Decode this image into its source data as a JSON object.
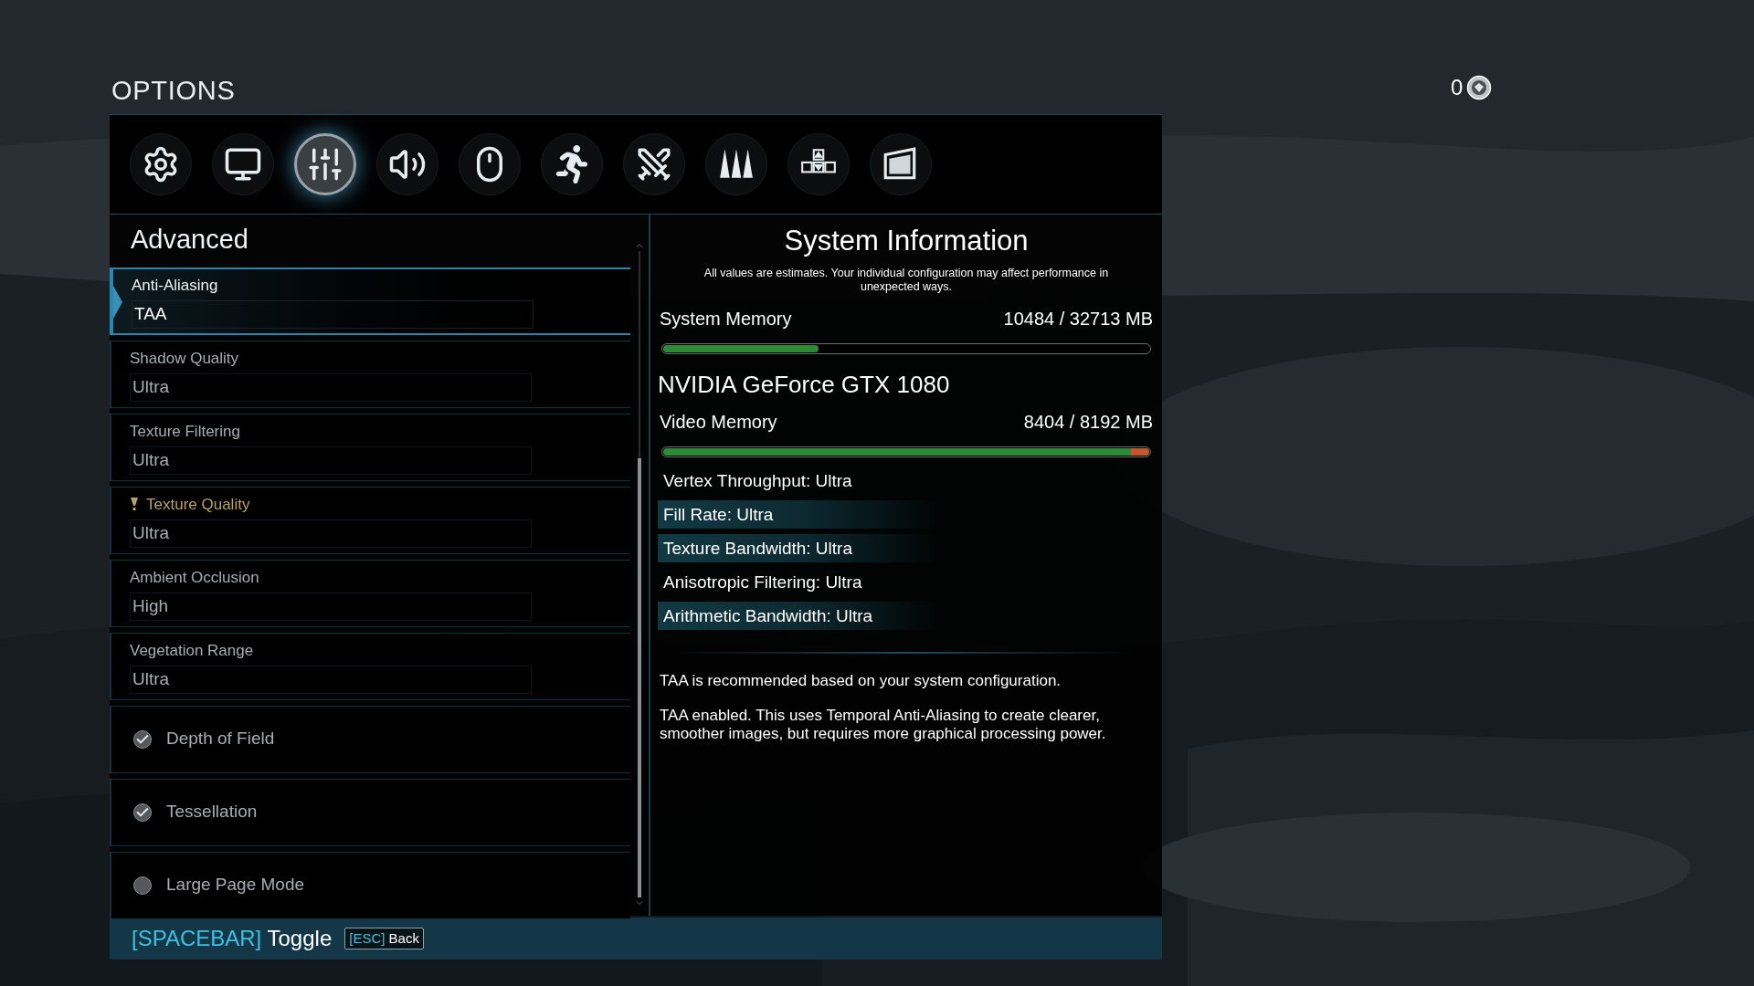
{
  "title": "OPTIONS",
  "currency": {
    "amount": "0"
  },
  "tabs": [
    {
      "kind": "general",
      "selected": false
    },
    {
      "kind": "display",
      "selected": false
    },
    {
      "kind": "graphics",
      "selected": true
    },
    {
      "kind": "audio",
      "selected": false
    },
    {
      "kind": "mouse",
      "selected": false
    },
    {
      "kind": "movement",
      "selected": false
    },
    {
      "kind": "combat",
      "selected": false
    },
    {
      "kind": "claws",
      "selected": false
    },
    {
      "kind": "keys",
      "selected": false
    },
    {
      "kind": "screen",
      "selected": false
    }
  ],
  "section": "Advanced",
  "settings": [
    {
      "kind": "dropdown",
      "label": "Anti-Aliasing",
      "value": "TAA",
      "selected": true,
      "warning": false
    },
    {
      "kind": "dropdown",
      "label": "Shadow Quality",
      "value": "Ultra",
      "selected": false,
      "warning": false
    },
    {
      "kind": "dropdown",
      "label": "Texture Filtering",
      "value": "Ultra",
      "selected": false,
      "warning": false
    },
    {
      "kind": "dropdown",
      "label": "Texture Quality",
      "value": "Ultra",
      "selected": false,
      "warning": true
    },
    {
      "kind": "dropdown",
      "label": "Ambient Occlusion",
      "value": "High",
      "selected": false,
      "warning": false
    },
    {
      "kind": "dropdown",
      "label": "Vegetation Range",
      "value": "Ultra",
      "selected": false,
      "warning": false
    },
    {
      "kind": "checkbox",
      "label": "Depth of Field",
      "checked": true,
      "selected": false
    },
    {
      "kind": "checkbox",
      "label": "Tessellation",
      "checked": true,
      "selected": false
    },
    {
      "kind": "checkbox",
      "label": "Large Page Mode",
      "checked": false,
      "selected": false
    }
  ],
  "system_info": {
    "title": "System Information",
    "note": "All values are estimates. Your individual configuration may affect performance in unexpected ways.",
    "system_memory": {
      "label": "System Memory",
      "reading": "10484 / 32713 MB",
      "level": 0.32,
      "over_limit": false
    },
    "gpu": "NVIDIA GeForce GTX 1080",
    "video_memory": {
      "label": "Video Memory",
      "reading": "8404 / 8192 MB",
      "level": 1,
      "over_limit": true
    },
    "stats": [
      {
        "text": "Vertex Throughput: Ultra",
        "highlighted": false
      },
      {
        "text": "Fill Rate: Ultra",
        "highlighted": true
      },
      {
        "text": "Texture Bandwidth: Ultra",
        "highlighted": true
      },
      {
        "text": "Anisotropic Filtering: Ultra",
        "highlighted": false
      },
      {
        "text": "Arithmetic Bandwidth: Ultra",
        "highlighted": true
      }
    ],
    "descriptions": [
      "TAA is recommended based on your system configuration.",
      "TAA enabled. This uses Temporal Anti-Aliasing to create clearer, smoother images, but requires more graphical processing power."
    ]
  },
  "footer": {
    "key": "[SPACEBAR]",
    "action": "Toggle",
    "back_key": "[ESC]",
    "back_action": "Back"
  }
}
